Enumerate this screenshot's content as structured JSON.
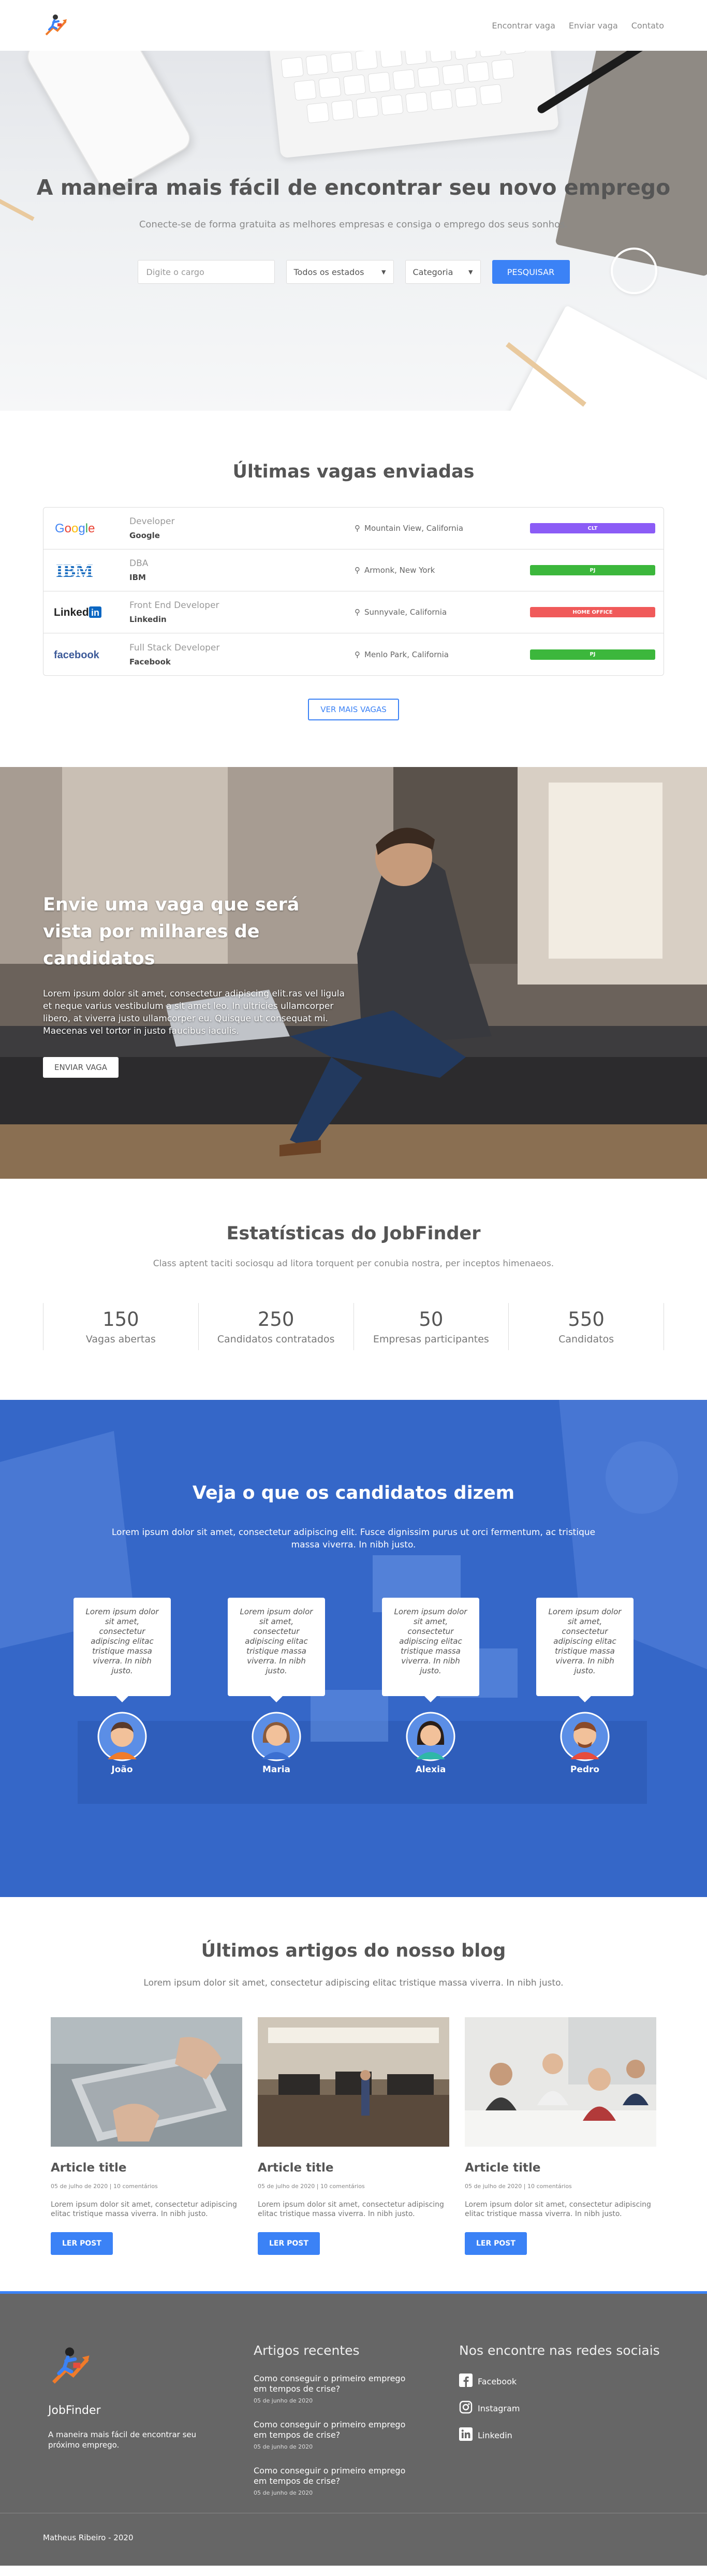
{
  "nav": {
    "links": [
      "Encontrar vaga",
      "Enviar vaga",
      "Contato"
    ]
  },
  "hero": {
    "title": "A maneira mais fácil de encontrar seu novo emprego",
    "subtitle": "Conecte-se de forma gratuita as melhores empresas e consiga o emprego dos seus sonhos.",
    "search_placeholder": "Digite o cargo",
    "state_select": "Todos os estados",
    "category_select": "Categoria",
    "search_button": "PESQUISAR"
  },
  "jobs": {
    "title": "Últimas vagas enviadas",
    "rows": [
      {
        "logo": "Google",
        "title": "Developer",
        "company": "Google",
        "location": "Mountain View, California",
        "type": "CLT",
        "type_color": "#8b5cf6"
      },
      {
        "logo": "IBM",
        "title": "DBA",
        "company": "IBM",
        "location": "Armonk, New York",
        "type": "PJ",
        "type_color": "#3cb73c"
      },
      {
        "logo": "LinkedIn",
        "title": "Front End Developer",
        "company": "Linkedin",
        "location": "Sunnyvale, California",
        "type": "HOME OFFICE",
        "type_color": "#f05a5a"
      },
      {
        "logo": "facebook",
        "title": "Full Stack Developer",
        "company": "Facebook",
        "location": "Menlo Park, California",
        "type": "PJ",
        "type_color": "#3cb73c"
      }
    ],
    "more_button": "VER MAIS VAGAS"
  },
  "post_job": {
    "title": "Envie uma vaga que será vista por milhares de candidatos",
    "text": "Lorem ipsum dolor sit amet, consectetur adipiscing elit.ras vel ligula et neque varius vestibulum a sit amet leo. In ultricies ullamcorper libero, at viverra justo ullamcorper eu. Quisque ut consequat mi. Maecenas vel tortor in justo faucibus iaculis.",
    "button": "ENVIAR VAGA"
  },
  "stats": {
    "title": "Estatísticas do JobFinder",
    "subtitle": "Class aptent taciti sociosqu ad litora torquent per conubia nostra, per inceptos himenaeos.",
    "items": [
      {
        "value": "150",
        "label": "Vagas abertas"
      },
      {
        "value": "250",
        "label": "Candidatos contratados"
      },
      {
        "value": "50",
        "label": "Empresas participantes"
      },
      {
        "value": "550",
        "label": "Candidatos"
      }
    ]
  },
  "testimonials": {
    "title": "Veja o que os candidatos dizem",
    "subtitle": "Lorem ipsum dolor sit amet, consectetur adipiscing elit. Fusce dignissim purus ut orci fermentum, ac tristique massa viverra. In nibh justo.",
    "items": [
      {
        "quote": "Lorem ipsum dolor sit amet, consectetur adipiscing elitac tristique massa viverra. In nibh justo.",
        "name": "João"
      },
      {
        "quote": "Lorem ipsum dolor sit amet, consectetur adipiscing elitac tristique massa viverra. In nibh justo.",
        "name": "Maria"
      },
      {
        "quote": "Lorem ipsum dolor sit amet, consectetur adipiscing elitac tristique massa viverra. In nibh justo.",
        "name": "Alexia"
      },
      {
        "quote": "Lorem ipsum dolor sit amet, consectetur adipiscing elitac tristique massa viverra. In nibh justo.",
        "name": "Pedro"
      }
    ]
  },
  "blog": {
    "title": "Últimos artigos do nosso blog",
    "subtitle": "Lorem ipsum dolor sit amet, consectetur adipiscing elitac tristique massa viverra. In nibh justo.",
    "posts": [
      {
        "title": "Article title",
        "meta": "05 de julho de 2020 | 10 comentários",
        "excerpt": "Lorem ipsum dolor sit amet, consectetur adipiscing elitac tristique massa viverra. In nibh justo.",
        "button": "LER POST"
      },
      {
        "title": "Article title",
        "meta": "05 de julho de 2020 | 10 comentários",
        "excerpt": "Lorem ipsum dolor sit amet, consectetur adipiscing elitac tristique massa viverra. In nibh justo.",
        "button": "LER POST"
      },
      {
        "title": "Article title",
        "meta": "05 de julho de 2020 | 10 comentários",
        "excerpt": "Lorem ipsum dolor sit amet, consectetur adipiscing elitac tristique massa viverra. In nibh justo.",
        "button": "LER POST"
      }
    ]
  },
  "footer": {
    "brand": "JobFinder",
    "description": "A maneira mais fácil de encontrar seu próximo emprego.",
    "recent_title": "Artigos recentes",
    "recent": [
      {
        "title": "Como conseguir o primeiro emprego em tempos de crise?",
        "date": "05 de junho de 2020"
      },
      {
        "title": "Como conseguir o primeiro emprego em tempos de crise?",
        "date": "05 de junho de 2020"
      },
      {
        "title": "Como conseguir o primeiro emprego em tempos de crise?",
        "date": "05 de junho de 2020"
      }
    ],
    "social_title": "Nos encontre nas redes sociais",
    "social": [
      {
        "label": "Facebook",
        "icon": "facebook-icon"
      },
      {
        "label": "Instagram",
        "icon": "instagram-icon"
      },
      {
        "label": "Linkedin",
        "icon": "linkedin-icon"
      }
    ],
    "copyright": "Matheus Ribeiro - 2020"
  },
  "colors": {
    "accent": "#3b82f6",
    "footer_bg": "#666666",
    "testimonial_overlay": "#3b6fd1"
  }
}
